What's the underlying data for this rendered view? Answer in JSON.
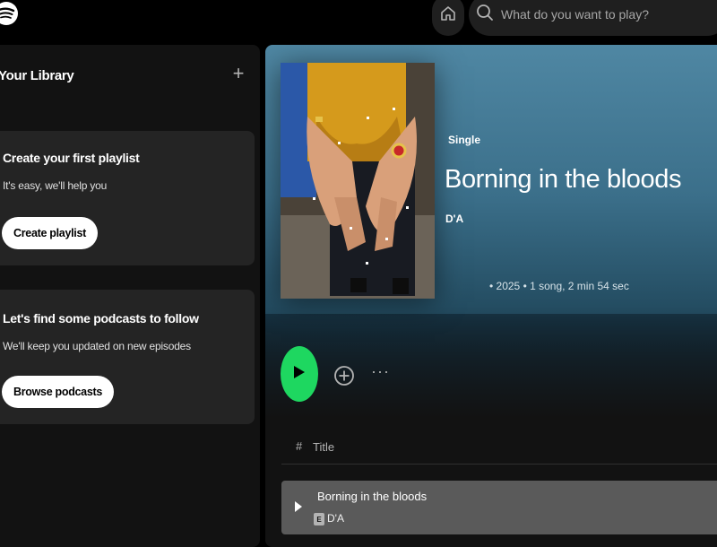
{
  "topbar": {
    "search_placeholder": "What do you want to play?"
  },
  "library": {
    "title": "Your Library",
    "add_symbol": "+",
    "cards": [
      {
        "title": "Create your first playlist",
        "subtitle": "It's easy, we'll help you",
        "button": "Create playlist"
      },
      {
        "title": "Let's find some podcasts to follow",
        "subtitle": "We'll keep you updated on new episodes",
        "button": "Browse podcasts"
      }
    ]
  },
  "release": {
    "type": "Single",
    "title": "Borning in the bloods",
    "artist": "D'A",
    "meta": "• 2025 • 1 song, 2 min 54 sec"
  },
  "actions": {
    "more": "···"
  },
  "tracklist": {
    "col_number": "#",
    "col_title": "Title",
    "tracks": [
      {
        "title": "Borning in the bloods",
        "explicit": "E",
        "artist": "D'A"
      }
    ]
  },
  "colors": {
    "accent": "#1ed760",
    "hero": "#3b6f8a",
    "background": "#121212"
  }
}
